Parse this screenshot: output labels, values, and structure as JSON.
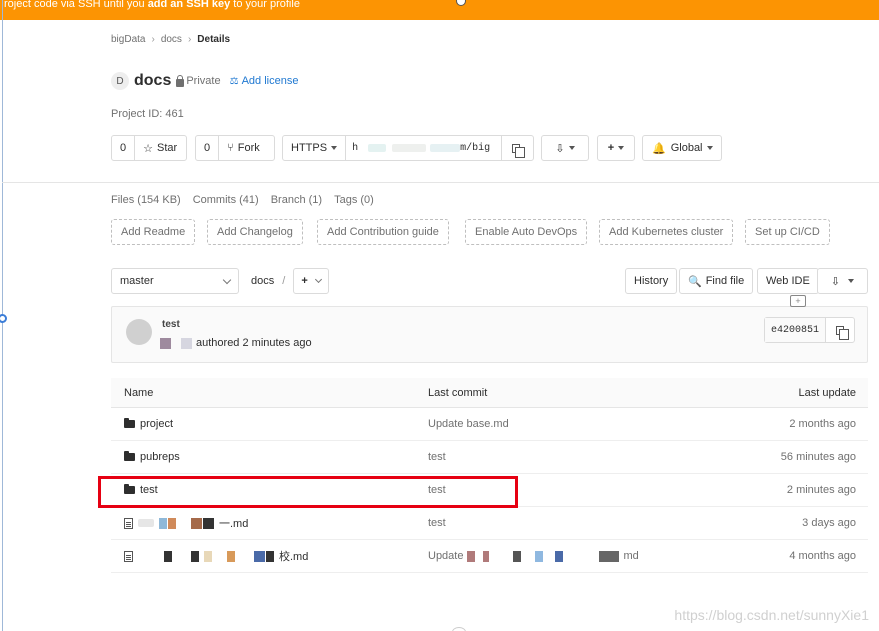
{
  "banner": {
    "prefix": "roject code via SSH until you ",
    "strong": "add an SSH key",
    "suffix": " to your profile"
  },
  "breadcrumb": [
    "bigData",
    "docs",
    "Details"
  ],
  "project": {
    "avatar_letter": "D",
    "name": "docs",
    "visibility": "Private",
    "add_license": "Add license",
    "project_id": "Project ID: 461"
  },
  "actions": {
    "star_count": "0",
    "star_label": "Star",
    "fork_count": "0",
    "fork_label": "Fork",
    "protocol": "HTTPS",
    "clone_start": "h",
    "clone_end": "m/big",
    "notifications_scope": "Global"
  },
  "stats": {
    "files": "Files (154 KB)",
    "commits": "Commits (41)",
    "branch": "Branch (1)",
    "tags": "Tags (0)"
  },
  "quick_actions": [
    "Add Readme",
    "Add Changelog",
    "Add Contribution guide",
    "Enable Auto DevOps",
    "Add Kubernetes cluster",
    "Set up CI/CD"
  ],
  "tree": {
    "branch": "master",
    "path": "docs",
    "path_sep": "/",
    "history": "History",
    "find_file": "Find file",
    "web_ide": "Web IDE"
  },
  "last_commit": {
    "title": "test",
    "meta": "authored 2 minutes ago",
    "sha": "e4200851"
  },
  "table": {
    "headers": [
      "Name",
      "Last commit",
      "Last update"
    ],
    "rows": [
      {
        "name": "project",
        "type": "folder",
        "commit": "Update base.md",
        "updated": "2 months ago"
      },
      {
        "name": "pubreps",
        "type": "folder",
        "commit": "test",
        "updated": "56 minutes ago"
      },
      {
        "name": "test",
        "type": "folder",
        "commit": "test",
        "updated": "2 minutes ago"
      },
      {
        "name": "一.md",
        "type": "file",
        "commit": "test",
        "updated": "3 days ago"
      },
      {
        "name": "校.md",
        "type": "file",
        "commit": "Update",
        "commit_suffix": "md",
        "updated": "4 months ago"
      }
    ]
  },
  "watermark": "https://blog.csdn.net/sunnyXie1"
}
